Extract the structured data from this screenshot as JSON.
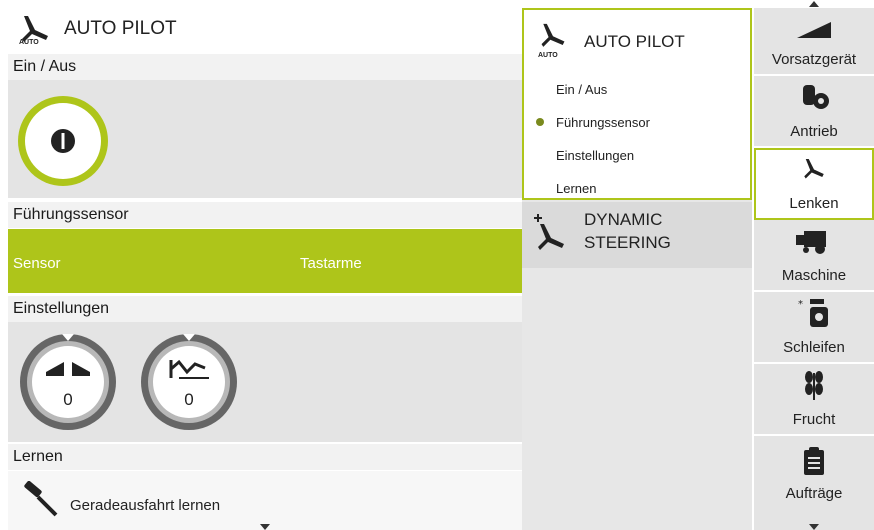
{
  "left": {
    "header": {
      "title": "AUTO PILOT",
      "icon_label": "AUTO"
    },
    "sections": {
      "on_off": {
        "title": "Ein / Aus"
      },
      "guidance": {
        "title": "Führungssensor",
        "sensor_label": "Sensor",
        "sensor_value": "Tastarme"
      },
      "settings": {
        "title": "Einstellungen",
        "dial1_value": "0",
        "dial2_value": "0"
      },
      "learn": {
        "title": "Lernen",
        "item_label": "Geradeausfahrt lernen"
      }
    }
  },
  "middle": {
    "autopilot": {
      "title": "AUTO PILOT",
      "icon_label": "AUTO",
      "items": [
        "Ein / Aus",
        "Führungssensor",
        "Einstellungen",
        "Lernen"
      ],
      "active_index": 1
    },
    "dynamic": {
      "title_line1": "DYNAMIC",
      "title_line2": "STEERING"
    }
  },
  "nav": {
    "items": [
      {
        "label": "Vorsatzgerät",
        "icon": "header-icon"
      },
      {
        "label": "Antrieb",
        "icon": "drive-gear-icon"
      },
      {
        "label": "Lenken",
        "icon": "steering-icon"
      },
      {
        "label": "Maschine",
        "icon": "harvester-icon"
      },
      {
        "label": "Schleifen",
        "icon": "grinder-icon"
      },
      {
        "label": "Frucht",
        "icon": "crop-icon"
      },
      {
        "label": "Aufträge",
        "icon": "clipboard-icon"
      }
    ],
    "active_index": 2
  },
  "colors": {
    "accent": "#aec51a",
    "panel": "#e4e4e4",
    "dark": "#222222"
  }
}
